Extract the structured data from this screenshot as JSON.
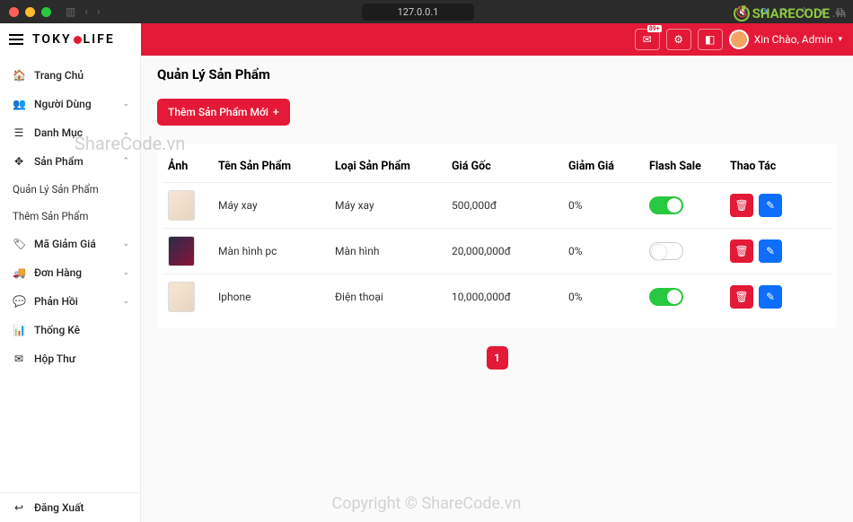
{
  "browser": {
    "url": "127.0.0.1",
    "sound_icon": "🔇"
  },
  "header": {
    "logo_part1": "TOKY",
    "logo_part2": "LIFE",
    "badge": "89+",
    "user_greeting": "Xin Chào, Admin"
  },
  "sidebar": {
    "home": "Trang Chủ",
    "users": "Người Dùng",
    "categories": "Danh Mục",
    "products": "Sản Phẩm",
    "products_sub1": "Quản Lý Sản Phẩm",
    "products_sub2": "Thêm Sản Phẩm",
    "discounts": "Mã Giảm Giá",
    "orders": "Đơn Hàng",
    "feedback": "Phản Hồi",
    "stats": "Thống Kê",
    "mailbox": "Hộp Thư",
    "logout": "Đăng Xuất"
  },
  "page": {
    "title": "Quản Lý Sản Phẩm",
    "add_button": "Thêm Sản Phẩm Mới",
    "cols": {
      "image": "Ảnh",
      "name": "Tên Sản Phẩm",
      "category": "Loại Sản Phẩm",
      "price": "Giá Gốc",
      "discount": "Giảm Giá",
      "flash": "Flash Sale",
      "actions": "Thao Tác"
    },
    "rows": [
      {
        "name": "Máy xay",
        "category": "Máy xay",
        "price": "500,000đ",
        "discount": "0%",
        "flash": true,
        "thumb_class": "thumb"
      },
      {
        "name": "Màn hình pc",
        "category": "Màn hình",
        "price": "20,000,000đ",
        "discount": "0%",
        "flash": false,
        "thumb_class": "thumb monitor"
      },
      {
        "name": "Iphone",
        "category": "Điện thoại",
        "price": "10,000,000đ",
        "discount": "0%",
        "flash": true,
        "thumb_class": "thumb"
      }
    ],
    "pager_current": "1"
  },
  "watermarks": {
    "logo_text": "SHARECODE",
    "logo_vn": ".vn",
    "mid": "ShareCode.vn",
    "bottom": "Copyright © ShareCode.vn"
  }
}
